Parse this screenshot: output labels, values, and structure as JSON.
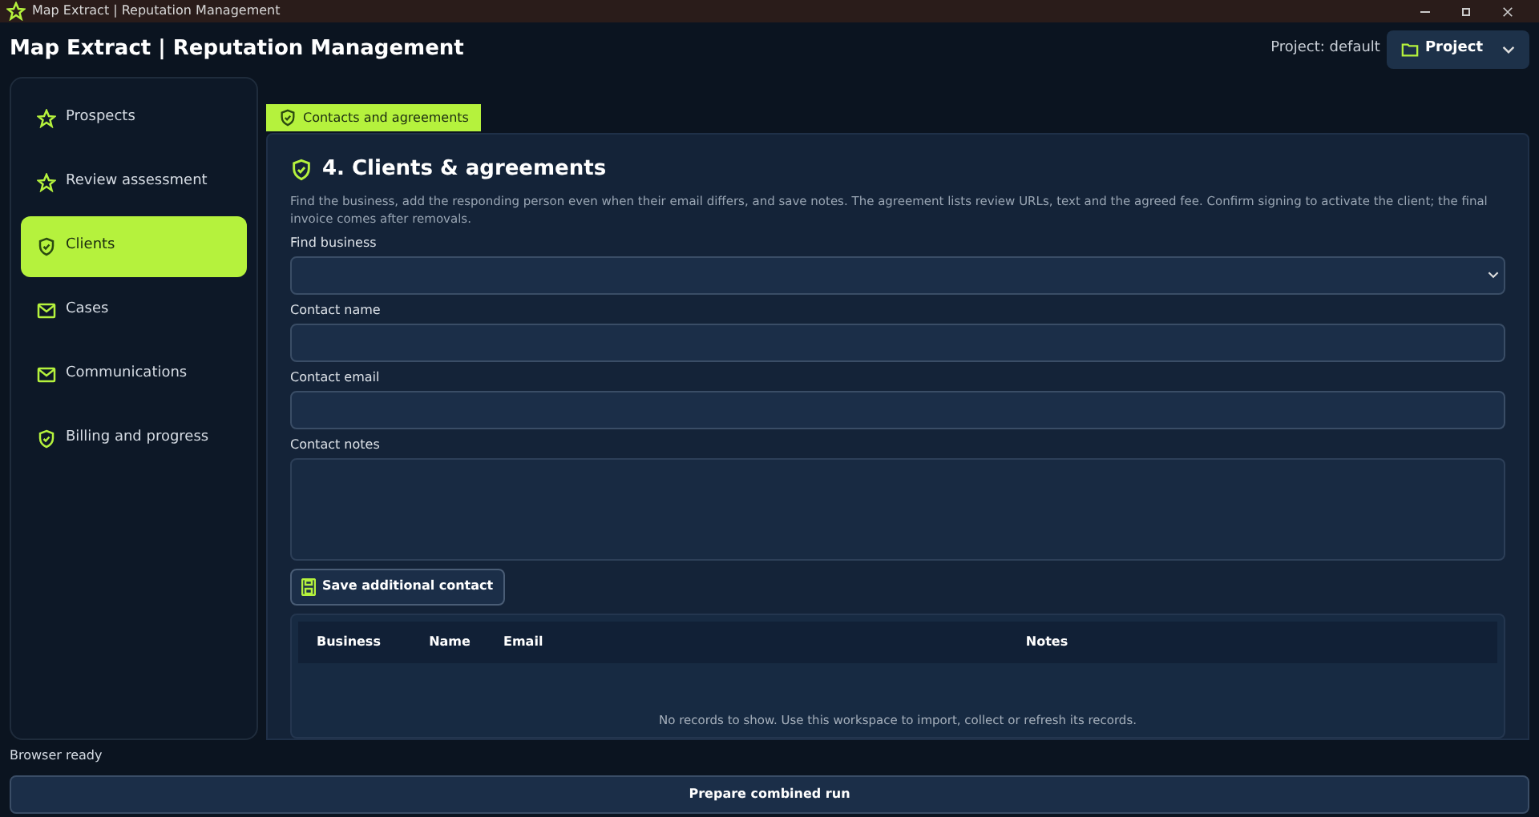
{
  "window": {
    "title": "Map Extract | Reputation Management"
  },
  "header": {
    "title": "Map Extract | Reputation Management",
    "project_label": "Project: default",
    "project_button": "Project"
  },
  "sidebar": {
    "items": [
      {
        "label": "Prospects",
        "selected": false
      },
      {
        "label": "Review assessment",
        "selected": false
      },
      {
        "label": "Clients",
        "selected": true
      },
      {
        "label": "Cases",
        "selected": false
      },
      {
        "label": "Communications",
        "selected": false
      },
      {
        "label": "Billing and progress",
        "selected": false
      }
    ]
  },
  "tab": {
    "label": "Contacts and agreements",
    "selected": true
  },
  "section": {
    "title": "4. Clients & agreements",
    "description": "Find the business, add the responding person even when their email differs, and save notes. The agreement lists review URLs, text and the agreed fee. Confirm signing to activate the client; the final invoice comes after removals.",
    "fields": [
      {
        "kind": "select",
        "label": "Find business"
      },
      {
        "kind": "text",
        "label": "Contact name"
      },
      {
        "kind": "text",
        "label": "Contact email"
      },
      {
        "kind": "textarea",
        "label": "Contact notes"
      }
    ],
    "save_button": "Save additional contact",
    "table": {
      "columns": [
        "Business",
        "Name",
        "Email",
        "Notes"
      ],
      "empty_text": "No records to show. Use this workspace to import, collect or refresh its records."
    }
  },
  "status_bar": {
    "text": "Browser ready",
    "button": "Prepare combined run"
  }
}
